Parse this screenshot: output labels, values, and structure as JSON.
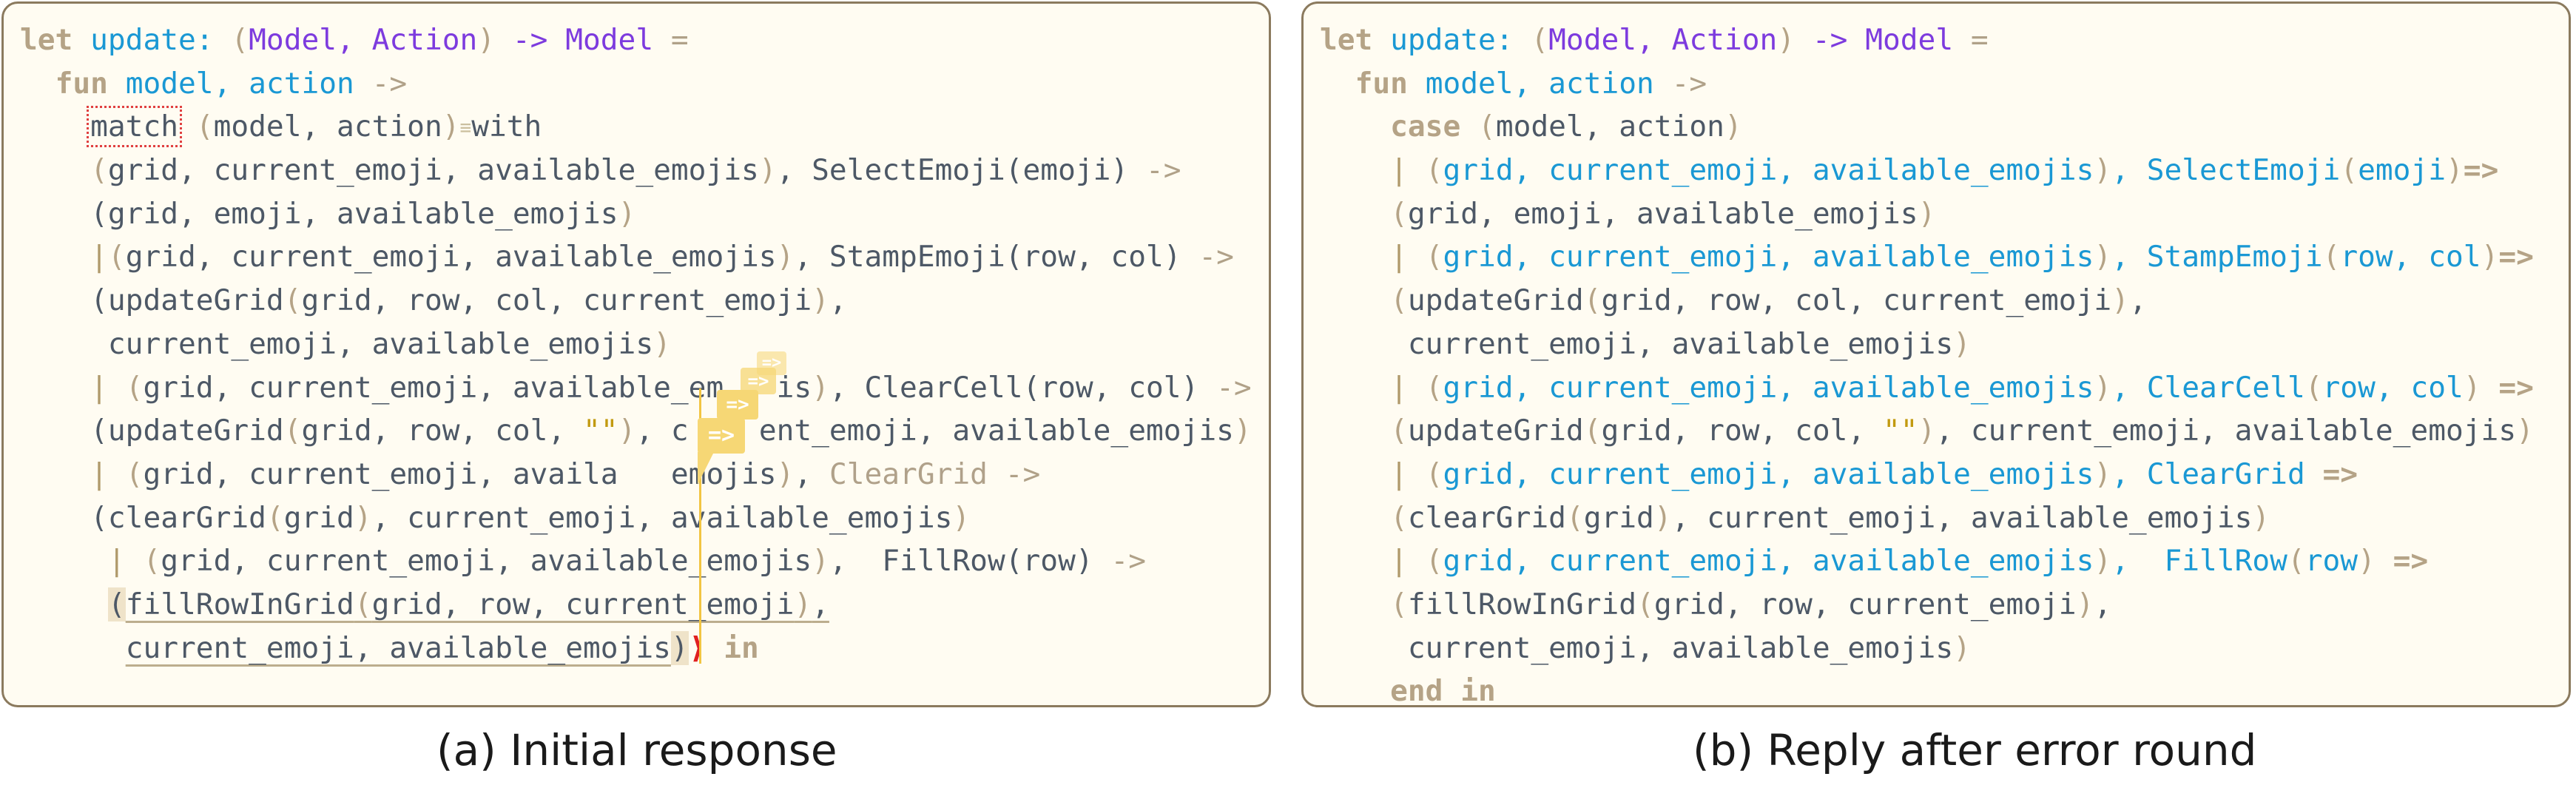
{
  "panel_a": {
    "caption": "(a) Initial response",
    "lines": [
      [
        {
          "t": "let",
          "c": "kw"
        },
        {
          "t": " "
        },
        {
          "t": "update:",
          "c": "id"
        },
        {
          "t": " "
        },
        {
          "t": "(",
          "c": "p"
        },
        {
          "t": "Model, Action",
          "c": "ty"
        },
        {
          "t": ")",
          "c": "p"
        },
        {
          "t": " "
        },
        {
          "t": "->",
          "c": "ty"
        },
        {
          "t": " "
        },
        {
          "t": "Model",
          "c": "ty"
        },
        {
          "t": " "
        },
        {
          "t": "=",
          "c": "op"
        }
      ],
      [
        {
          "t": "  "
        },
        {
          "t": "fun",
          "c": "kw"
        },
        {
          "t": " "
        },
        {
          "t": "model, action",
          "c": "id"
        },
        {
          "t": " "
        },
        {
          "t": "->",
          "c": "op"
        }
      ],
      [
        {
          "t": "    "
        },
        {
          "t": "match",
          "c": "err-box"
        },
        {
          "t": " "
        },
        {
          "t": "(",
          "c": "p"
        },
        {
          "t": "model, action"
        },
        {
          "t": ")",
          "c": "p"
        },
        {
          "t": "≡",
          "c": "tiny"
        },
        {
          "t": "with"
        }
      ],
      [
        {
          "t": "    "
        },
        {
          "t": "(",
          "c": "p"
        },
        {
          "t": "grid, current_emoji, available_emojis"
        },
        {
          "t": ")",
          "c": "p"
        },
        {
          "t": ", SelectEmoji(emoji) "
        },
        {
          "t": "->",
          "c": "op"
        }
      ],
      [
        {
          "t": "    "
        },
        {
          "t": "(grid, emoji, available_emojis"
        },
        {
          "t": ")",
          "c": "p"
        }
      ],
      [
        {
          "t": "    "
        },
        {
          "t": "|",
          "c": "gold"
        },
        {
          "t": "(",
          "c": "p"
        },
        {
          "t": "grid, current_emoji, available_emojis"
        },
        {
          "t": ")",
          "c": "p"
        },
        {
          "t": ", StampEmoji(row, col) "
        },
        {
          "t": "->",
          "c": "op"
        }
      ],
      [
        {
          "t": "    "
        },
        {
          "t": "(updateGrid"
        },
        {
          "t": "(",
          "c": "p"
        },
        {
          "t": "grid, row, col, current_emoji"
        },
        {
          "t": ")",
          "c": "p"
        },
        {
          "t": ","
        }
      ],
      [
        {
          "t": "     "
        },
        {
          "t": "current_emoji, available_emojis"
        },
        {
          "t": ")",
          "c": "p"
        }
      ],
      [
        {
          "t": "    "
        },
        {
          "t": "|",
          "c": "gold"
        },
        {
          "t": " "
        },
        {
          "t": "(",
          "c": "p"
        },
        {
          "t": "grid, current_emoji, available_em"
        },
        {
          "t": "   ",
          "c": ""
        },
        {
          "t": "is"
        },
        {
          "t": ")",
          "c": "p"
        },
        {
          "t": ", ClearCell(row, col) "
        },
        {
          "t": "->",
          "c": "op"
        }
      ],
      [
        {
          "t": "    "
        },
        {
          "t": "(updateGrid"
        },
        {
          "t": "(",
          "c": "p"
        },
        {
          "t": "grid, row, col, "
        },
        {
          "t": "\"\"",
          "c": "str"
        },
        {
          "t": ")",
          "c": "p"
        },
        {
          "t": ", c"
        },
        {
          "t": "    ",
          "c": ""
        },
        {
          "t": "ent_emoji, available_emojis"
        },
        {
          "t": ")",
          "c": "p"
        }
      ],
      [
        {
          "t": "    "
        },
        {
          "t": "|",
          "c": "gold"
        },
        {
          "t": " "
        },
        {
          "t": "(",
          "c": "p"
        },
        {
          "t": "grid, current_emoji, availa"
        },
        {
          "t": "   ",
          "c": ""
        },
        {
          "t": "emojis"
        },
        {
          "t": ")",
          "c": "p"
        },
        {
          "t": ", "
        },
        {
          "t": "ClearGrid",
          "c": "gray"
        },
        {
          "t": " "
        },
        {
          "t": "->",
          "c": "op"
        }
      ],
      [
        {
          "t": "    "
        },
        {
          "t": "(clearGrid"
        },
        {
          "t": "(",
          "c": "p"
        },
        {
          "t": "grid"
        },
        {
          "t": ")",
          "c": "p"
        },
        {
          "t": ", current_emoji, available_emojis"
        },
        {
          "t": ")",
          "c": "p"
        }
      ],
      [
        {
          "t": "     "
        },
        {
          "t": "|",
          "c": "gold"
        },
        {
          "t": " "
        },
        {
          "t": "(",
          "c": "p"
        },
        {
          "t": "grid, current_emoji, available_emojis"
        },
        {
          "t": ")",
          "c": "p"
        },
        {
          "t": ",  FillRow(row) "
        },
        {
          "t": "->",
          "c": "op"
        }
      ],
      [
        {
          "t": "     "
        },
        {
          "t": "(",
          "c": "hl"
        },
        {
          "t": "fillRowInGrid",
          "c": "uline"
        },
        {
          "t": "(",
          "c": "p uline"
        },
        {
          "t": "grid, row, current_emoji",
          "c": "uline"
        },
        {
          "t": ")",
          "c": "p uline"
        },
        {
          "t": ",",
          "c": "uline"
        }
      ],
      [
        {
          "t": "      "
        },
        {
          "t": "current_emoji, available_emojis",
          "c": "uline"
        },
        {
          "t": ")",
          "c": "hl"
        },
        {
          "t": "⟩",
          "c": "redparen"
        },
        {
          "t": " "
        },
        {
          "t": "in",
          "c": "kw"
        }
      ]
    ],
    "popups": [
      "=>",
      "=>",
      "=>",
      "=>"
    ]
  },
  "panel_b": {
    "caption": "(b) Reply after error round",
    "lines": [
      [
        {
          "t": "let",
          "c": "kw"
        },
        {
          "t": " "
        },
        {
          "t": "update:",
          "c": "id"
        },
        {
          "t": " "
        },
        {
          "t": "(",
          "c": "p"
        },
        {
          "t": "Model, Action",
          "c": "ty"
        },
        {
          "t": ")",
          "c": "p"
        },
        {
          "t": " "
        },
        {
          "t": "->",
          "c": "ty"
        },
        {
          "t": " "
        },
        {
          "t": "Model",
          "c": "ty"
        },
        {
          "t": " "
        },
        {
          "t": "=",
          "c": "op"
        }
      ],
      [
        {
          "t": "  "
        },
        {
          "t": "fun",
          "c": "kw"
        },
        {
          "t": " "
        },
        {
          "t": "model, action",
          "c": "id"
        },
        {
          "t": " "
        },
        {
          "t": "->",
          "c": "op"
        }
      ],
      [
        {
          "t": "    "
        },
        {
          "t": "case",
          "c": "kw"
        },
        {
          "t": " "
        },
        {
          "t": "(",
          "c": "p"
        },
        {
          "t": "model, action"
        },
        {
          "t": ")",
          "c": "p"
        }
      ],
      [
        {
          "t": "    "
        },
        {
          "t": "|",
          "c": "gold"
        },
        {
          "t": " "
        },
        {
          "t": "(",
          "c": "p"
        },
        {
          "t": "grid, current_emoji, available_emojis",
          "c": "id"
        },
        {
          "t": ")",
          "c": "p"
        },
        {
          "t": ", SelectEmoji",
          "c": "id"
        },
        {
          "t": "(",
          "c": "p"
        },
        {
          "t": "emoji",
          "c": "id"
        },
        {
          "t": ")",
          "c": "p"
        },
        {
          "t": "=>",
          "c": "kw"
        }
      ],
      [
        {
          "t": "    "
        },
        {
          "t": "(",
          "c": "p"
        },
        {
          "t": "grid, emoji, available_emojis"
        },
        {
          "t": ")",
          "c": "p"
        }
      ],
      [
        {
          "t": "    "
        },
        {
          "t": "|",
          "c": "gold"
        },
        {
          "t": " "
        },
        {
          "t": "(",
          "c": "p"
        },
        {
          "t": "grid, current_emoji, available_emojis",
          "c": "id"
        },
        {
          "t": ")",
          "c": "p"
        },
        {
          "t": ", StampEmoji",
          "c": "id"
        },
        {
          "t": "(",
          "c": "p"
        },
        {
          "t": "row, col",
          "c": "id"
        },
        {
          "t": ")",
          "c": "p"
        },
        {
          "t": "=>",
          "c": "kw"
        }
      ],
      [
        {
          "t": "    "
        },
        {
          "t": "(",
          "c": "p"
        },
        {
          "t": "updateGrid"
        },
        {
          "t": "(",
          "c": "p"
        },
        {
          "t": "grid, row, col, current_emoji"
        },
        {
          "t": ")",
          "c": "p"
        },
        {
          "t": ","
        }
      ],
      [
        {
          "t": "     "
        },
        {
          "t": "current_emoji, available_emojis"
        },
        {
          "t": ")",
          "c": "p"
        }
      ],
      [
        {
          "t": "    "
        },
        {
          "t": "|",
          "c": "gold"
        },
        {
          "t": " "
        },
        {
          "t": "(",
          "c": "p"
        },
        {
          "t": "grid, current_emoji, available_emojis",
          "c": "id"
        },
        {
          "t": ")",
          "c": "p"
        },
        {
          "t": ", ClearCell",
          "c": "id"
        },
        {
          "t": "(",
          "c": "p"
        },
        {
          "t": "row, col",
          "c": "id"
        },
        {
          "t": ")",
          "c": "p"
        },
        {
          "t": " "
        },
        {
          "t": "=>",
          "c": "kw"
        }
      ],
      [
        {
          "t": "    "
        },
        {
          "t": "(",
          "c": "p"
        },
        {
          "t": "updateGrid"
        },
        {
          "t": "(",
          "c": "p"
        },
        {
          "t": "grid, row, col, "
        },
        {
          "t": "\"\"",
          "c": "str"
        },
        {
          "t": ")",
          "c": "p"
        },
        {
          "t": ", current_emoji, available_emojis"
        },
        {
          "t": ")",
          "c": "p"
        }
      ],
      [
        {
          "t": "    "
        },
        {
          "t": "|",
          "c": "gold"
        },
        {
          "t": " "
        },
        {
          "t": "(",
          "c": "p"
        },
        {
          "t": "grid, current_emoji, available_emojis",
          "c": "id"
        },
        {
          "t": ")",
          "c": "p"
        },
        {
          "t": ", ClearGrid",
          "c": "id"
        },
        {
          "t": " "
        },
        {
          "t": "=>",
          "c": "kw"
        }
      ],
      [
        {
          "t": "    "
        },
        {
          "t": "(",
          "c": "p"
        },
        {
          "t": "clearGrid"
        },
        {
          "t": "(",
          "c": "p"
        },
        {
          "t": "grid"
        },
        {
          "t": ")",
          "c": "p"
        },
        {
          "t": ", current_emoji, available_emojis"
        },
        {
          "t": ")",
          "c": "p"
        }
      ],
      [
        {
          "t": "    "
        },
        {
          "t": "|",
          "c": "gold"
        },
        {
          "t": " "
        },
        {
          "t": "(",
          "c": "p"
        },
        {
          "t": "grid, current_emoji, available_emojis",
          "c": "id"
        },
        {
          "t": ")",
          "c": "p"
        },
        {
          "t": ",  FillRow",
          "c": "id"
        },
        {
          "t": "(",
          "c": "p"
        },
        {
          "t": "row",
          "c": "id"
        },
        {
          "t": ")",
          "c": "p"
        },
        {
          "t": " "
        },
        {
          "t": "=>",
          "c": "kw"
        }
      ],
      [
        {
          "t": "    "
        },
        {
          "t": "(",
          "c": "p"
        },
        {
          "t": "fillRowInGrid"
        },
        {
          "t": "(",
          "c": "p"
        },
        {
          "t": "grid, row, current_emoji"
        },
        {
          "t": ")",
          "c": "p"
        },
        {
          "t": ","
        }
      ],
      [
        {
          "t": "     "
        },
        {
          "t": "current_emoji, available_emojis"
        },
        {
          "t": ")",
          "c": "p"
        }
      ],
      [
        {
          "t": "    "
        },
        {
          "t": "end",
          "c": "kw"
        },
        {
          "t": " "
        },
        {
          "t": "in",
          "c": "kw"
        }
      ]
    ]
  }
}
